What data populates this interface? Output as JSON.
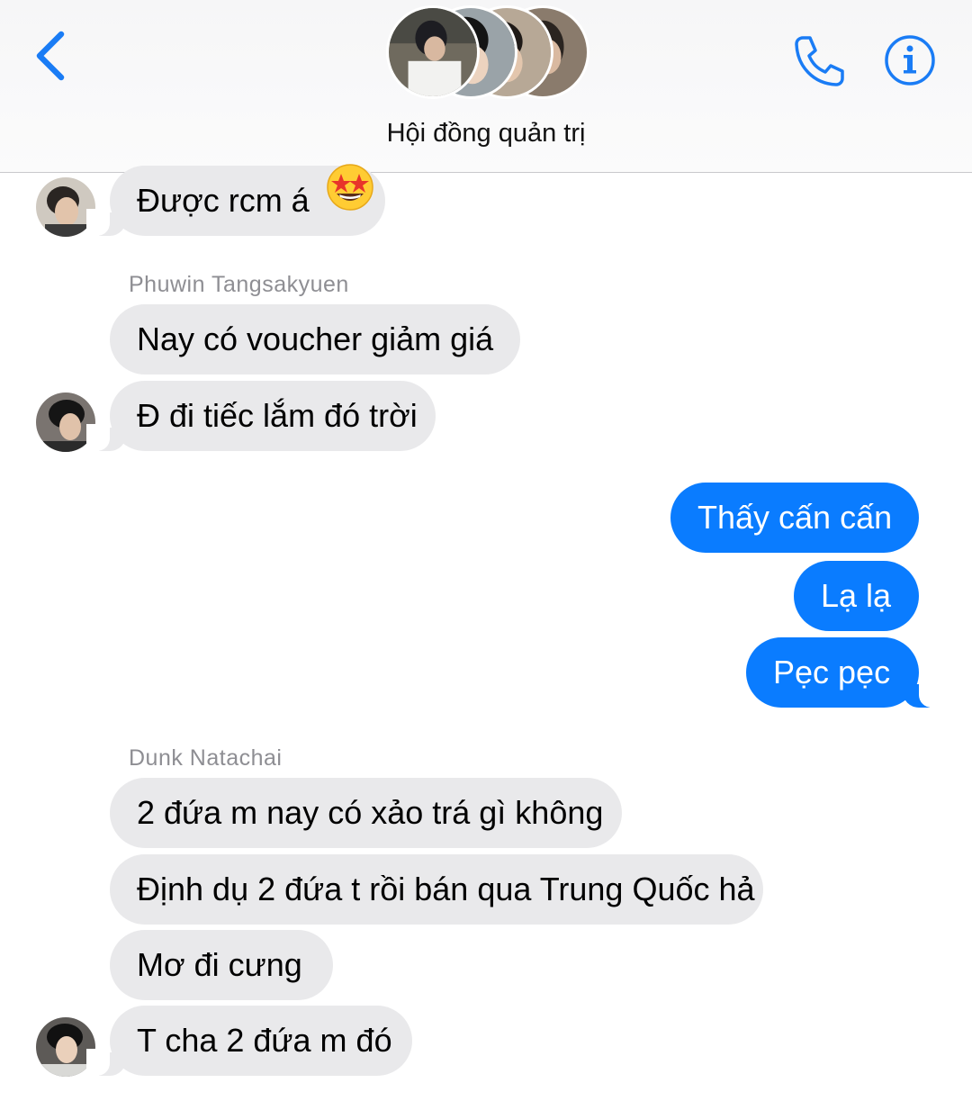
{
  "header": {
    "title": "Hội đồng quản trị",
    "back_icon": "chevron-left-icon",
    "call_icon": "phone-icon",
    "info_icon": "info-icon",
    "accent": "#1a7cf5"
  },
  "messages": [
    {
      "direction": "incoming",
      "text": "Được rcm á",
      "emoji": "star-struck-emoji"
    },
    {
      "sender": "Phuwin Tangsakyuen"
    },
    {
      "direction": "incoming",
      "text": "Nay có voucher giảm giá"
    },
    {
      "direction": "incoming",
      "text": "Đ đi tiếc lắm đó trời"
    },
    {
      "direction": "outgoing",
      "text": "Thấy cấn cấn"
    },
    {
      "direction": "outgoing",
      "text": "Lạ lạ"
    },
    {
      "direction": "outgoing",
      "text": "Pẹc pẹc"
    },
    {
      "sender": "Dunk Natachai"
    },
    {
      "direction": "incoming",
      "text": "2 đứa m nay có xảo trá gì không"
    },
    {
      "direction": "incoming",
      "text": "Định dụ 2 đứa t rồi bán qua Trung Quốc hả"
    },
    {
      "direction": "incoming",
      "text": "Mơ đi cưng"
    },
    {
      "direction": "incoming",
      "text": "T cha 2 đứa m đó"
    }
  ],
  "colors": {
    "incoming_bubble": "#e9e9eb",
    "outgoing_bubble": "#0a7cff",
    "sender_name": "#8e8e93"
  }
}
